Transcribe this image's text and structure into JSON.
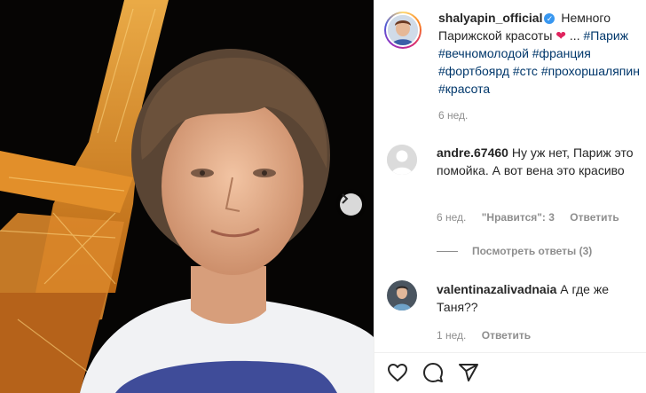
{
  "post": {
    "author": "shalyapin_official",
    "caption": "Немного Парижской красоты",
    "caption_heart": "❤",
    "caption_more": " ... ",
    "hashtags": "#Париж #вечномолодой #франция #фортбоярд #стс #прохоршаляпин #красота",
    "time": "6 нед."
  },
  "comments": [
    {
      "user": "andre.67460",
      "text": "Ну уж нет, Париж это помойка. А вот вена это красиво",
      "time": "6 нед.",
      "likes": "\"Нравится\": 3",
      "reply": "Ответить",
      "view_replies": "Посмотреть ответы (3)"
    },
    {
      "user": "valentinazalivadnaia",
      "text": "А где же Таня??",
      "time": "1 нед.",
      "reply": "Ответить"
    }
  ],
  "icons": {
    "like": "heart-icon",
    "comment": "comment-icon",
    "share": "share-icon",
    "next": "chevron-right-icon",
    "verified": "verified-badge-icon"
  },
  "colors": {
    "link": "#00376b",
    "muted": "#8e8e8e",
    "verified": "#3897f0",
    "tower_light": "#f3a735"
  }
}
